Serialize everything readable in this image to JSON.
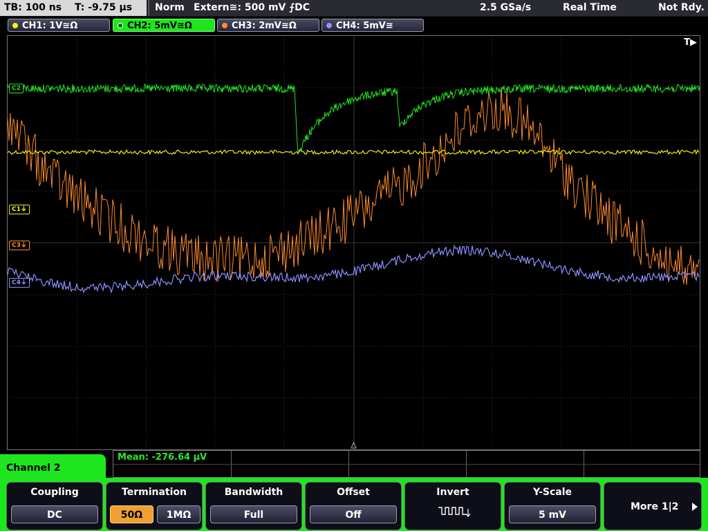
{
  "header": {
    "timebase": "TB: 100 ns",
    "trigger_time": "T: -9.75 µs",
    "trigger_mode": "Norm",
    "trigger_source": "Extern≅: 500 mV ⨍DC",
    "sample_rate": "2.5 GSa/s",
    "acq_mode": "Real Time",
    "status": "Not Rdy."
  },
  "channels": [
    {
      "label": "CH1: 1V≅Ω",
      "color": "#f4f01a",
      "active": false
    },
    {
      "label": "CH2: 5mV≅Ω",
      "color": "#22e622",
      "active": true
    },
    {
      "label": "CH3: 2mV≅Ω",
      "color": "#ff8c2a",
      "active": false
    },
    {
      "label": "CH4: 5mV≅",
      "color": "#8f8fff",
      "active": false
    }
  ],
  "screen": {
    "trigger_marker": "T▶",
    "markers": {
      "c2": "C2",
      "c1": "C1⏚",
      "c3": "C3⏚",
      "c4": "C4⏚"
    }
  },
  "measurement": {
    "text": "Mean: -276.64 µV"
  },
  "menu": {
    "title": "Channel 2",
    "coupling": {
      "title": "Coupling",
      "value": "DC"
    },
    "termination": {
      "title": "Termination",
      "opt1": "50Ω",
      "opt2": "1MΩ"
    },
    "bandwidth": {
      "title": "Bandwidth",
      "value": "Full"
    },
    "offset": {
      "title": "Offset",
      "value": "Off"
    },
    "invert": {
      "title": "Invert"
    },
    "yscale": {
      "title": "Y-Scale",
      "value": "5 mV"
    },
    "more": {
      "label": "More 1|2"
    }
  }
}
